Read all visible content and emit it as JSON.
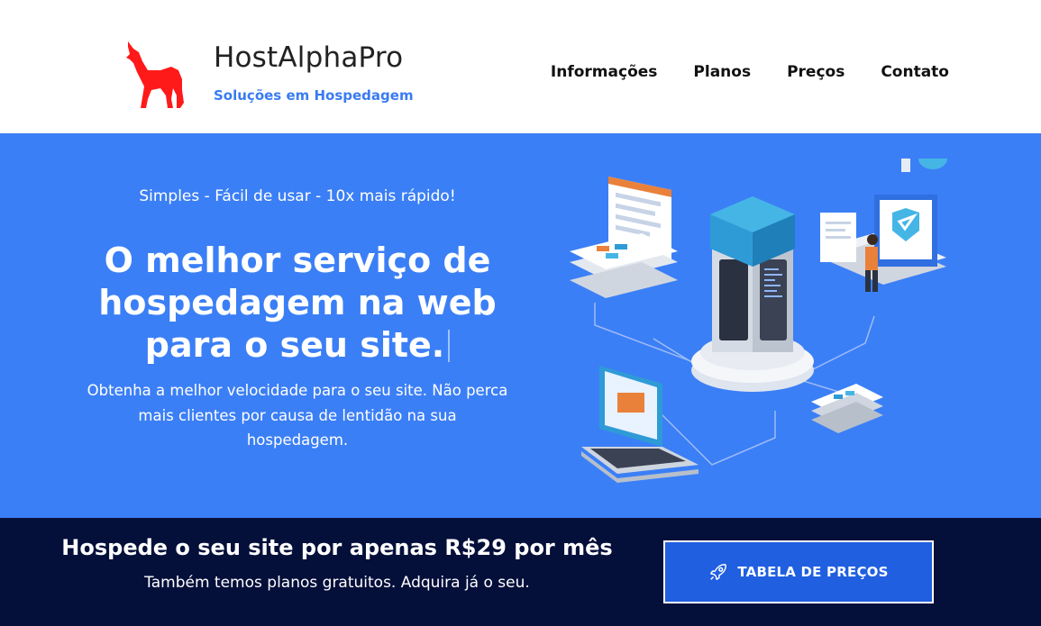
{
  "header": {
    "brand_name": "HostAlphaPro",
    "brand_tagline": "Soluções em Hospedagem",
    "logo_icon": "wolf-icon",
    "logo_color": "#ff1a1a",
    "nav": [
      {
        "label": "Informações"
      },
      {
        "label": "Planos"
      },
      {
        "label": "Preços"
      },
      {
        "label": "Contato"
      }
    ]
  },
  "hero": {
    "background": "#3b7ff6",
    "tagline": "Simples - Fácil de usar - 10x mais rápido!",
    "title_lines": [
      "O melhor serviço de",
      "hospedagem na web",
      "para o seu site."
    ],
    "description": "Obtenha a melhor velocidade para o seu site. Não perca mais clientes por causa de lentidão na sua hospedagem."
  },
  "banner": {
    "background": "#040f3a",
    "title": "Hospede o seu site por apenas R$29 por mês",
    "subtitle": "Também temos planos gratuitos. Adquira já o seu.",
    "cta_label": "TABELA DE PREÇOS",
    "cta_icon": "rocket-icon",
    "cta_color": "#1f5fe0"
  }
}
